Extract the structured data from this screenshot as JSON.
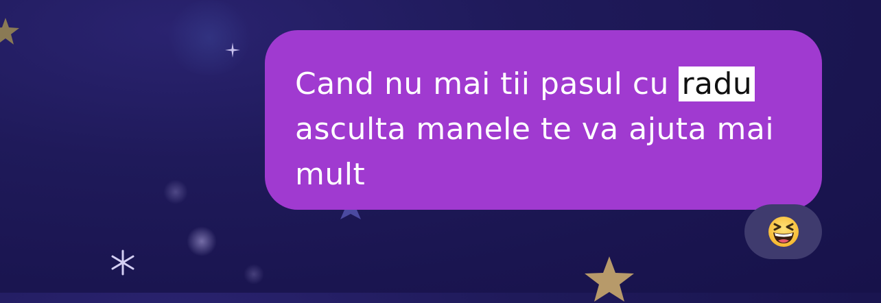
{
  "message": {
    "text_before": "Cand nu mai tii pasul cu ",
    "highlighted_word": "radu",
    "text_after": " asculta manele te va ajuta mai mult"
  },
  "reaction": {
    "icon": "grinning-squinting-face-icon"
  },
  "colors": {
    "background": "#1c1653",
    "bubble": "#a03ad0",
    "reaction_bg": "#3f3b6e",
    "highlight": "#ffffff"
  }
}
